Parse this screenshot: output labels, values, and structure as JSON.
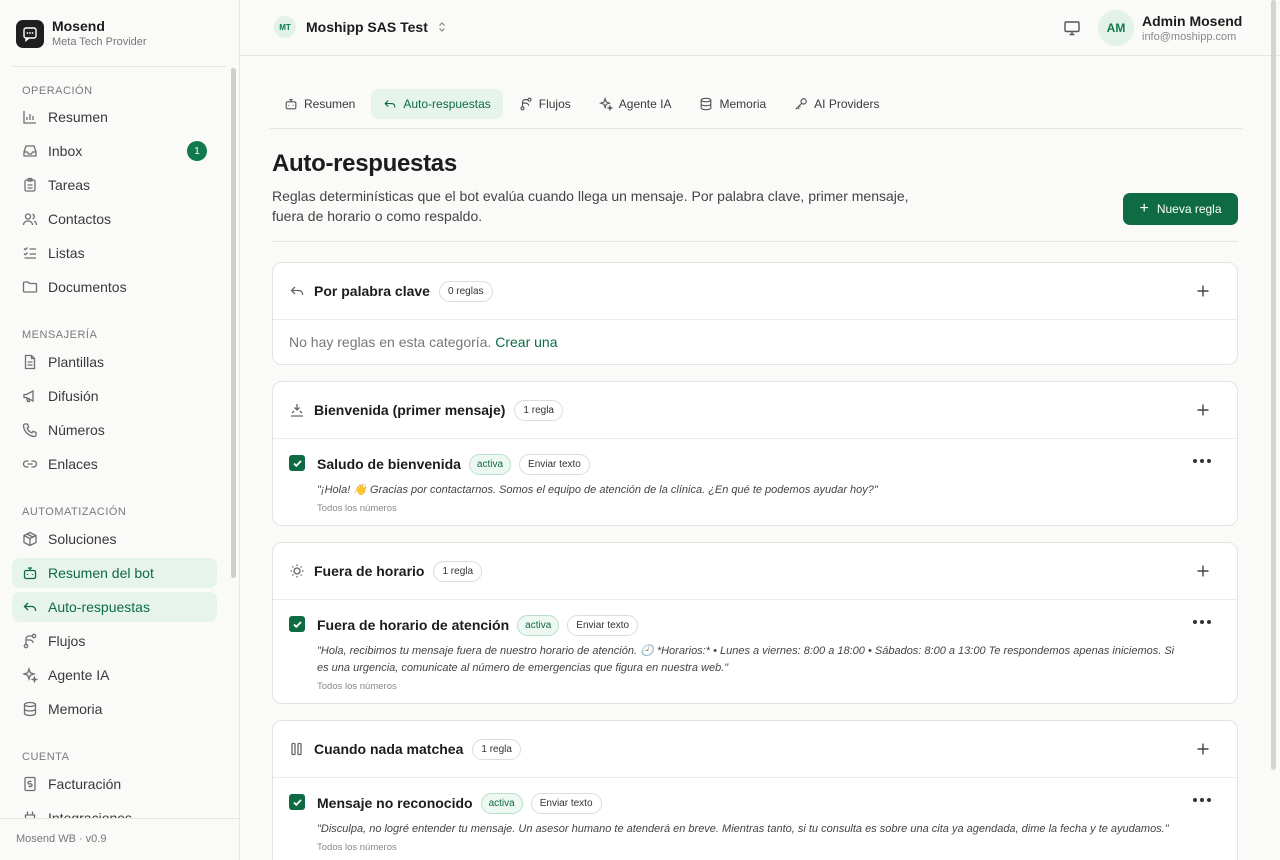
{
  "brand": {
    "name": "Mosend",
    "subtitle": "Meta Tech Provider"
  },
  "sidebar": {
    "sections": [
      {
        "title": "OPERACIÓN",
        "items": [
          {
            "label": "Resumen",
            "icon": "bar-chart-icon"
          },
          {
            "label": "Inbox",
            "icon": "inbox-icon",
            "badge": "1"
          },
          {
            "label": "Tareas",
            "icon": "clipboard-icon"
          },
          {
            "label": "Contactos",
            "icon": "users-icon"
          },
          {
            "label": "Listas",
            "icon": "list-checks-icon"
          },
          {
            "label": "Documentos",
            "icon": "folder-icon"
          }
        ]
      },
      {
        "title": "MENSAJERÍA",
        "items": [
          {
            "label": "Plantillas",
            "icon": "file-text-icon"
          },
          {
            "label": "Difusión",
            "icon": "megaphone-icon"
          },
          {
            "label": "Números",
            "icon": "phone-icon"
          },
          {
            "label": "Enlaces",
            "icon": "link-icon"
          }
        ]
      },
      {
        "title": "AUTOMATIZACIÓN",
        "items": [
          {
            "label": "Soluciones",
            "icon": "package-icon"
          },
          {
            "label": "Resumen del bot",
            "icon": "bot-icon"
          },
          {
            "label": "Auto-respuestas",
            "icon": "reply-icon"
          },
          {
            "label": "Flujos",
            "icon": "workflow-icon"
          },
          {
            "label": "Agente IA",
            "icon": "sparkles-icon"
          },
          {
            "label": "Memoria",
            "icon": "database-icon"
          }
        ]
      },
      {
        "title": "CUENTA",
        "items": [
          {
            "label": "Facturación",
            "icon": "receipt-icon"
          },
          {
            "label": "Integraciones",
            "icon": "plug-icon"
          }
        ]
      }
    ],
    "footer": "Mosend WB · v0.9"
  },
  "topbar": {
    "workspace_initials": "MT",
    "workspace_name": "Moshipp SAS Test",
    "user_initials": "AM",
    "user_name": "Admin Mosend",
    "user_email": "info@moshipp.com"
  },
  "tabs": [
    {
      "label": "Resumen",
      "icon": "bot-icon"
    },
    {
      "label": "Auto-respuestas",
      "icon": "reply-icon",
      "active": true
    },
    {
      "label": "Flujos",
      "icon": "workflow-icon"
    },
    {
      "label": "Agente IA",
      "icon": "sparkles-icon"
    },
    {
      "label": "Memoria",
      "icon": "database-icon"
    },
    {
      "label": "AI Providers",
      "icon": "key-icon"
    }
  ],
  "page": {
    "title": "Auto-respuestas",
    "description": "Reglas determinísticas que el bot evalúa cuando llega un mensaje. Por palabra clave, primer mensaje, fuera de horario o como respaldo.",
    "new_button": "Nueva regla"
  },
  "categories": {
    "keyword": {
      "title": "Por palabra clave",
      "count": "0 reglas",
      "empty_text": "No hay reglas en esta categoría.",
      "empty_link": "Crear una"
    },
    "welcome": {
      "title": "Bienvenida (primer mensaje)",
      "count": "1 regla",
      "rule": {
        "name": "Saludo de bienvenida",
        "status": "activa",
        "action": "Enviar texto",
        "message": "\"¡Hola! 👋 Gracias por contactarnos. Somos el equipo de atención de la clínica. ¿En qué te podemos ayudar hoy?\"",
        "scope": "Todos los números"
      }
    },
    "after_hours": {
      "title": "Fuera de horario",
      "count": "1 regla",
      "rule": {
        "name": "Fuera de horario de atención",
        "status": "activa",
        "action": "Enviar texto",
        "message": "\"Hola, recibimos tu mensaje fuera de nuestro horario de atención. 🕘 *Horarios:* • Lunes a viernes: 8:00 a 18:00 • Sábados: 8:00 a 13:00 Te respondemos apenas iniciemos. Si es una urgencia, comunicate al número de emergencias que figura en nuestra web.\"",
        "scope": "Todos los números"
      }
    },
    "fallback": {
      "title": "Cuando nada matchea",
      "count": "1 regla",
      "rule": {
        "name": "Mensaje no reconocido",
        "status": "activa",
        "action": "Enviar texto",
        "message": "\"Disculpa, no logré entender tu mensaje. Un asesor humano te atenderá en breve. Mientras tanto, si tu consulta es sobre una cita ya agendada, dime la fecha y te ayudamos.\"",
        "scope": "Todos los números"
      }
    }
  },
  "colors": {
    "accent": "#0e6b43",
    "accent_bg": "#e6f4ec"
  }
}
